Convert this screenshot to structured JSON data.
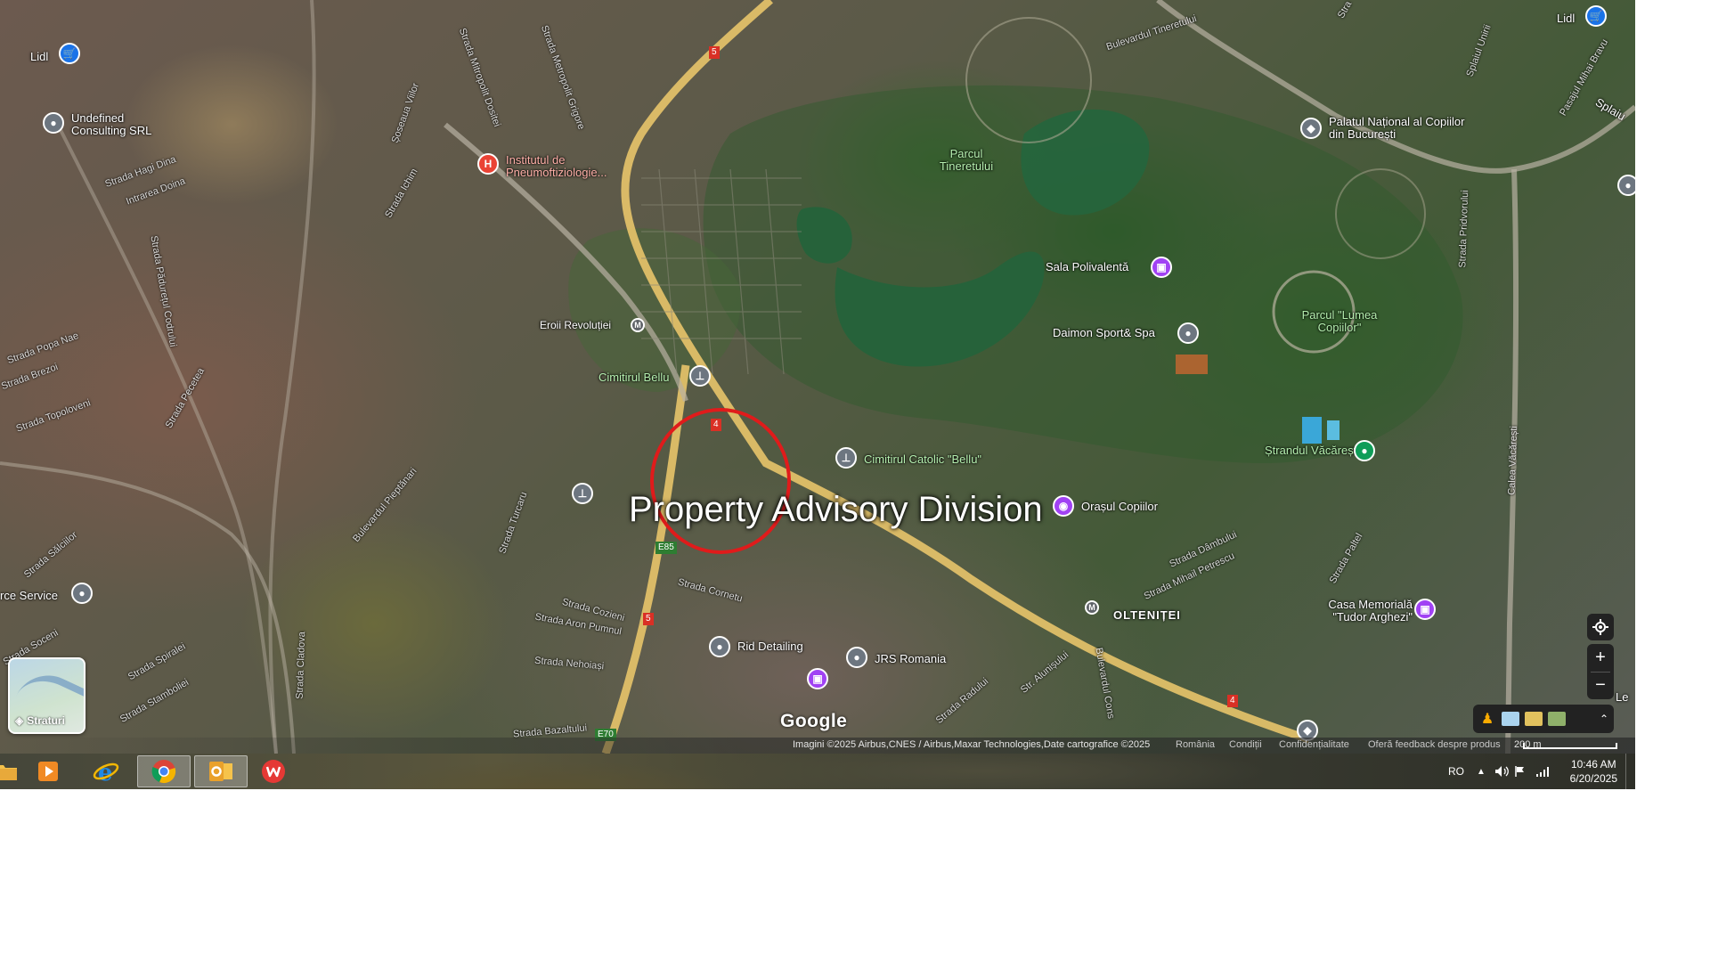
{
  "map": {
    "places": {
      "lidl_left": "Lidl",
      "lidl_right": "Lidl",
      "undefined_consulting": "Undefined Consulting SRL",
      "institutul": "Institutul de Pneumoftiziologie...",
      "parcul_tineretului": "Parcul Tineretului",
      "palatul": "Palatul Național al Copiilor din București",
      "sala_polivalenta": "Sala Polivalentă",
      "daimon": "Daimon Sport& Spa",
      "eroii_revolutiei": "Eroii Revoluției",
      "cimitirul_bellu": "Cimitirul Bellu",
      "parcul_lumea_copiilor": "Parcul \"Lumea Copiilor\"",
      "strandul_vacaresti": "Ștrandul Văcărești",
      "cimitirul_catolic": "Cimitirul Catolic \"Bellu\"",
      "orasul_copiilor": "Orașul Copiilor",
      "casa_memoriala": "Casa Memorială \"Tudor Arghezi\"",
      "oltenitei": "OLTENIȚEI",
      "rid_detailing": "Rid Detailing",
      "jrs_romania": "JRS Romania",
      "service_left": "rce Service"
    },
    "streets": {
      "s1": "Bulevardul Tineretului",
      "s2": "Strada Metropolit Grigore",
      "s3": "Strada Mitropolit Dositei",
      "s4": "Șoseaua Viilor",
      "s5": "Strada Hagi Dina",
      "s6": "Intrarea Doina",
      "s7": "Strada Pădurețul Codrului",
      "s8": "Strada Popa Nae",
      "s9": "Strada Topoloveni",
      "s10": "Strada Pecetea",
      "s11": "Bulevardul Pieptănari",
      "s12": "Strada Cozieni",
      "s13": "Strada Aron Pumnul",
      "s14": "Strada Cornetu",
      "s15": "Strada Nehoiași",
      "s16": "Strada Bazaltului",
      "s17": "Strada Cladova",
      "s18": "Strada Dâmbului",
      "s19": "Strada Mihail Petrescu",
      "s20": "Str. Alunișului",
      "s21": "Bulevardul Cons",
      "s22": "Strada Radului",
      "s23": "Calea Văcărești",
      "s24": "Strada Pridvorului",
      "s25": "Splaiul Unirii",
      "s26": "Pasajul Mihai Bravu",
      "s27": "Strada Turcaru",
      "s28": "Strada Sălciilor",
      "s29": "Strada Spiralei",
      "s30": "Strada Stamboliei",
      "s31": "Strada Soceni",
      "s32": "Strada Brezoi",
      "s33": "Strada Ichim",
      "s34": "Strada Paltel"
    },
    "roads": {
      "e85": "E85",
      "e70": "E70",
      "r5": "5",
      "r4": "4"
    },
    "edge_labels": {
      "le": "Le",
      "splaiu": "Splaiu",
      "strada_top": "Stra"
    },
    "watermark": "Property Advisory Division",
    "layers_button_label": "Straturi",
    "google_logo": "Google",
    "zoom_in": "+",
    "zoom_out": "−",
    "attribution": {
      "imagery": "Imagini ©2025 Airbus,CNES / Airbus,Maxar Technologies,Date cartografice ©2025",
      "country": "România",
      "terms": "Condiții",
      "privacy": "Confidențialitate",
      "feedback": "Oferă feedback despre produs",
      "scale": "200 m"
    }
  },
  "taskbar": {
    "apps": [
      "file-explorer",
      "media-player",
      "internet-explorer",
      "chrome",
      "outlook",
      "wps-office"
    ],
    "active_app": "chrome",
    "tray": {
      "language": "RO",
      "time": "10:46 AM",
      "date": "6/20/2025"
    }
  },
  "colors": {
    "highlight": "#e01b1b",
    "road": "#e8c46a",
    "lake": "#1f6e4a"
  }
}
